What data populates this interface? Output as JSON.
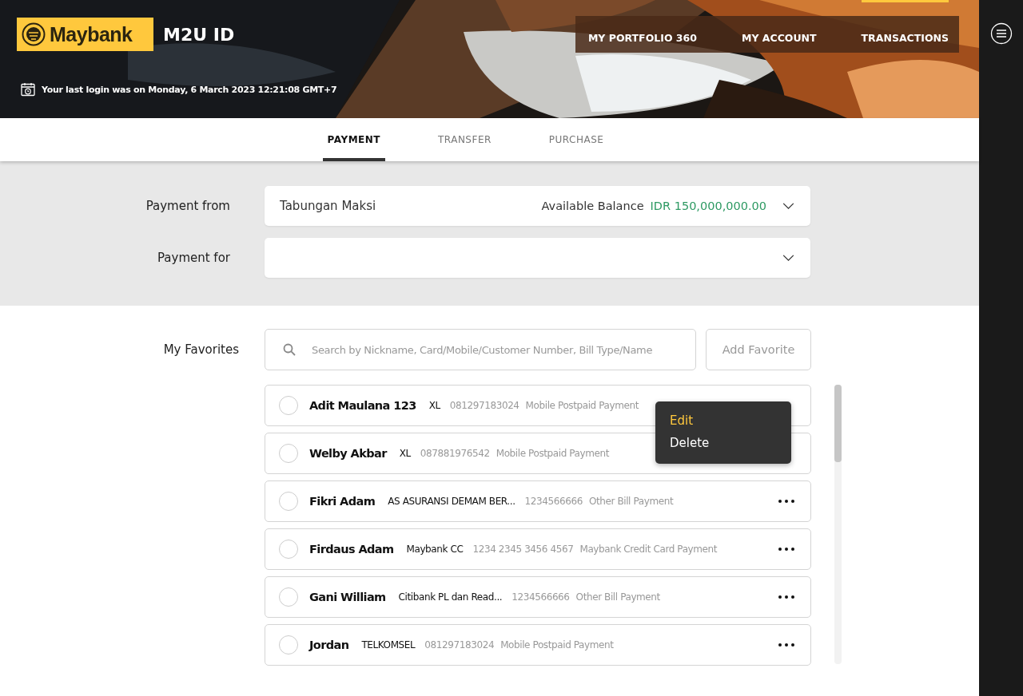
{
  "header": {
    "brand": "Maybank",
    "product": "M2U ID",
    "last_login": "Your last login was on Monday, 6 March 2023 12:21:08 GMT+7",
    "nav": [
      {
        "label": "MY PORTFOLIO 360",
        "selected": false
      },
      {
        "label": "MY ACCOUNT",
        "selected": false
      },
      {
        "label": "TRANSACTIONS",
        "selected": true
      }
    ]
  },
  "tabs": [
    {
      "label": "PAYMENT",
      "selected": true
    },
    {
      "label": "TRANSFER",
      "selected": false
    },
    {
      "label": "PURCHASE",
      "selected": false
    }
  ],
  "form": {
    "payment_from": {
      "label": "Payment from",
      "value": "Tabungan Maksi",
      "balance_label": "Available Balance",
      "balance": "IDR 150,000,000.00"
    },
    "payment_for": {
      "label": "Payment for"
    }
  },
  "favorites": {
    "label": "My Favorites",
    "search": {
      "placeholder": "Search by Nickname, Card/Mobile/Customer Number, Bill Type/Name"
    },
    "add_button": "Add Favorite",
    "items": [
      {
        "name": "Adit Maulana 123",
        "biller": "XL",
        "number": "081297183024",
        "type": "Mobile Postpaid Payment",
        "selected": false,
        "menu_open": true
      },
      {
        "name": "Welby Akbar",
        "biller": "XL",
        "number": "087881976542",
        "type": "Mobile Postpaid Payment",
        "selected": false,
        "menu_open": false
      },
      {
        "name": "Fikri Adam",
        "biller": "AS ASURANSI DEMAM BER...",
        "number": "1234566666",
        "type": "Other Bill Payment",
        "selected": false,
        "menu_open": false
      },
      {
        "name": "Firdaus Adam",
        "biller": "Maybank CC",
        "number": "1234 2345 3456 4567",
        "type": "Maybank Credit Card Payment",
        "selected": false,
        "menu_open": false
      },
      {
        "name": "Gani William",
        "biller": "Citibank PL dan Read...",
        "number": "1234566666",
        "type": "Other Bill Payment",
        "selected": false,
        "menu_open": false
      },
      {
        "name": "Jordan",
        "biller": "TELKOMSEL",
        "number": "081297183024",
        "type": "Mobile Postpaid Payment",
        "selected": false,
        "menu_open": false
      }
    ],
    "menu": [
      {
        "label": "Edit",
        "selected": true
      },
      {
        "label": "Delete",
        "selected": false
      }
    ]
  }
}
